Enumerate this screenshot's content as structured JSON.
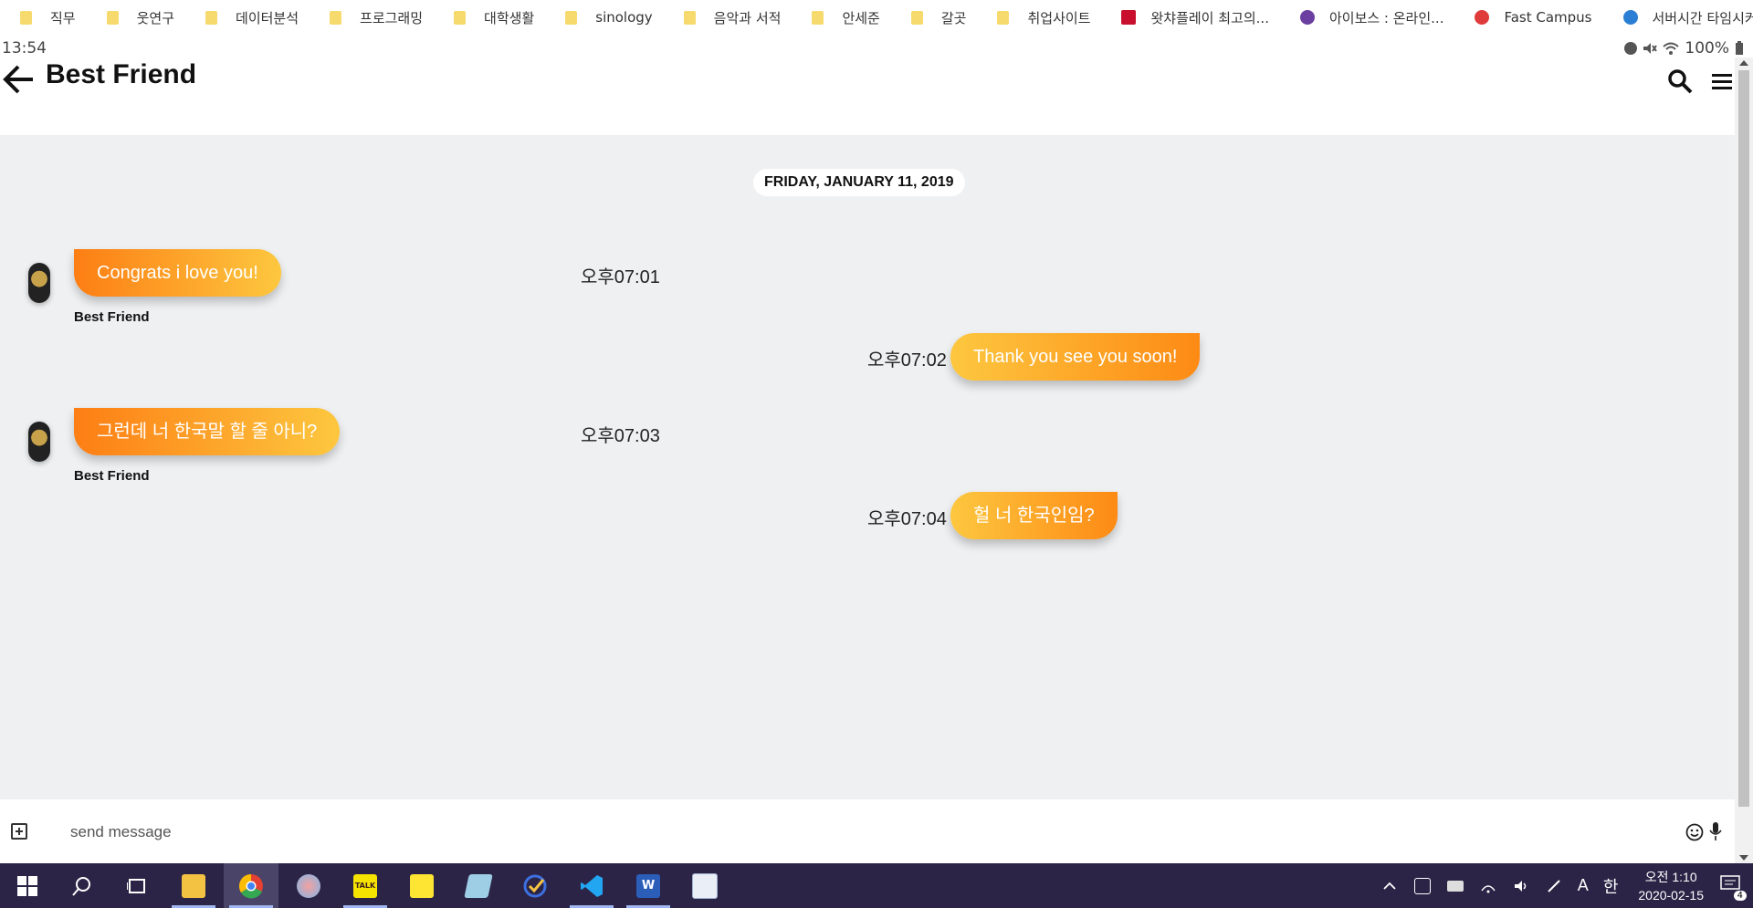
{
  "bookmarks": [
    {
      "label": "직무",
      "type": "folder"
    },
    {
      "label": "웃연구",
      "type": "folder"
    },
    {
      "label": "데이터분석",
      "type": "folder"
    },
    {
      "label": "프로그래밍",
      "type": "folder"
    },
    {
      "label": "대학생활",
      "type": "folder"
    },
    {
      "label": "sinology",
      "type": "folder"
    },
    {
      "label": "음악과 서적",
      "type": "folder"
    },
    {
      "label": "안세준",
      "type": "folder"
    },
    {
      "label": "갈곳",
      "type": "folder"
    },
    {
      "label": "취업사이트",
      "type": "folder"
    },
    {
      "label": "왓챠플레이 최고의...",
      "type": "site",
      "color": "#c8102e"
    },
    {
      "label": "아이보스 : 온라인...",
      "type": "site",
      "color": "#6b3fa0"
    },
    {
      "label": "Fast Campus",
      "type": "site",
      "color": "#e03b3b"
    },
    {
      "label": "서버시간 타임시커",
      "type": "site",
      "color": "#2a7fd4"
    }
  ],
  "status": {
    "time": "13:54",
    "battery": "100%"
  },
  "header": {
    "title": "Best Friend",
    "back_icon": "arrow-left-icon",
    "search_icon": "search-icon",
    "menu_icon": "hamburger-menu-icon"
  },
  "chat": {
    "date": "FRIDAY, JANUARY 11, 2019",
    "messages": [
      {
        "direction": "in",
        "text": "Congrats i love you!",
        "sender": "Best Friend",
        "time": "오후07:01"
      },
      {
        "direction": "out",
        "text": "Thank you see you soon!",
        "time": "오후07:02"
      },
      {
        "direction": "in",
        "text": "그런데 너 한국말 할 줄 아니?",
        "sender": "Best Friend",
        "time": "오후07:03"
      },
      {
        "direction": "out",
        "text": "헐 너 한국인임?",
        "time": "오후07:04"
      }
    ]
  },
  "composer": {
    "placeholder": "send message",
    "add_icon": "plus-square-icon",
    "emoji_icon": "smiley-icon",
    "mic_icon": "microphone-icon"
  },
  "taskbar": {
    "clock_time": "오전 1:10",
    "clock_date": "2020-02-15",
    "ime_mode": "A",
    "ime_lang": "한",
    "notification_count": "4",
    "apps": [
      "start",
      "search",
      "task-view",
      "file-explorer",
      "chrome",
      "paint",
      "kakaotalk",
      "sticky-notes",
      "app-notes",
      "todo",
      "vscode",
      "word",
      "editor"
    ]
  },
  "colors": {
    "bubble_orange": "#fd7e14",
    "bubble_yellow": "#fdc73f",
    "chat_bg": "#eef0f2",
    "taskbar_bg": "#2b2446"
  }
}
